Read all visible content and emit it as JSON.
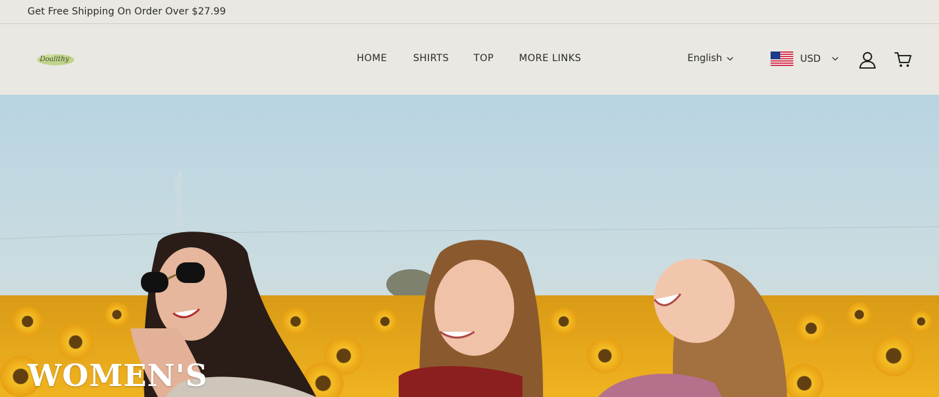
{
  "announcement": {
    "text": "Get Free Shipping On Order Over $27.99"
  },
  "header": {
    "logo_text": "Doallthy",
    "nav": [
      {
        "label": "HOME"
      },
      {
        "label": "SHIRTS"
      },
      {
        "label": "TOP"
      },
      {
        "label": "MORE LINKS"
      }
    ],
    "language": {
      "selected": "English"
    },
    "currency": {
      "selected": "USD",
      "flag": "us-flag-icon"
    },
    "icons": [
      "account-icon",
      "cart-icon"
    ]
  },
  "hero": {
    "title": "WOMEN'S",
    "image": "three-women-laughing-in-sunflower-field",
    "colors": {
      "sky_top": "#b7d3e0",
      "sky_bottom": "#d7e3e2",
      "field": "#e8a516"
    }
  }
}
